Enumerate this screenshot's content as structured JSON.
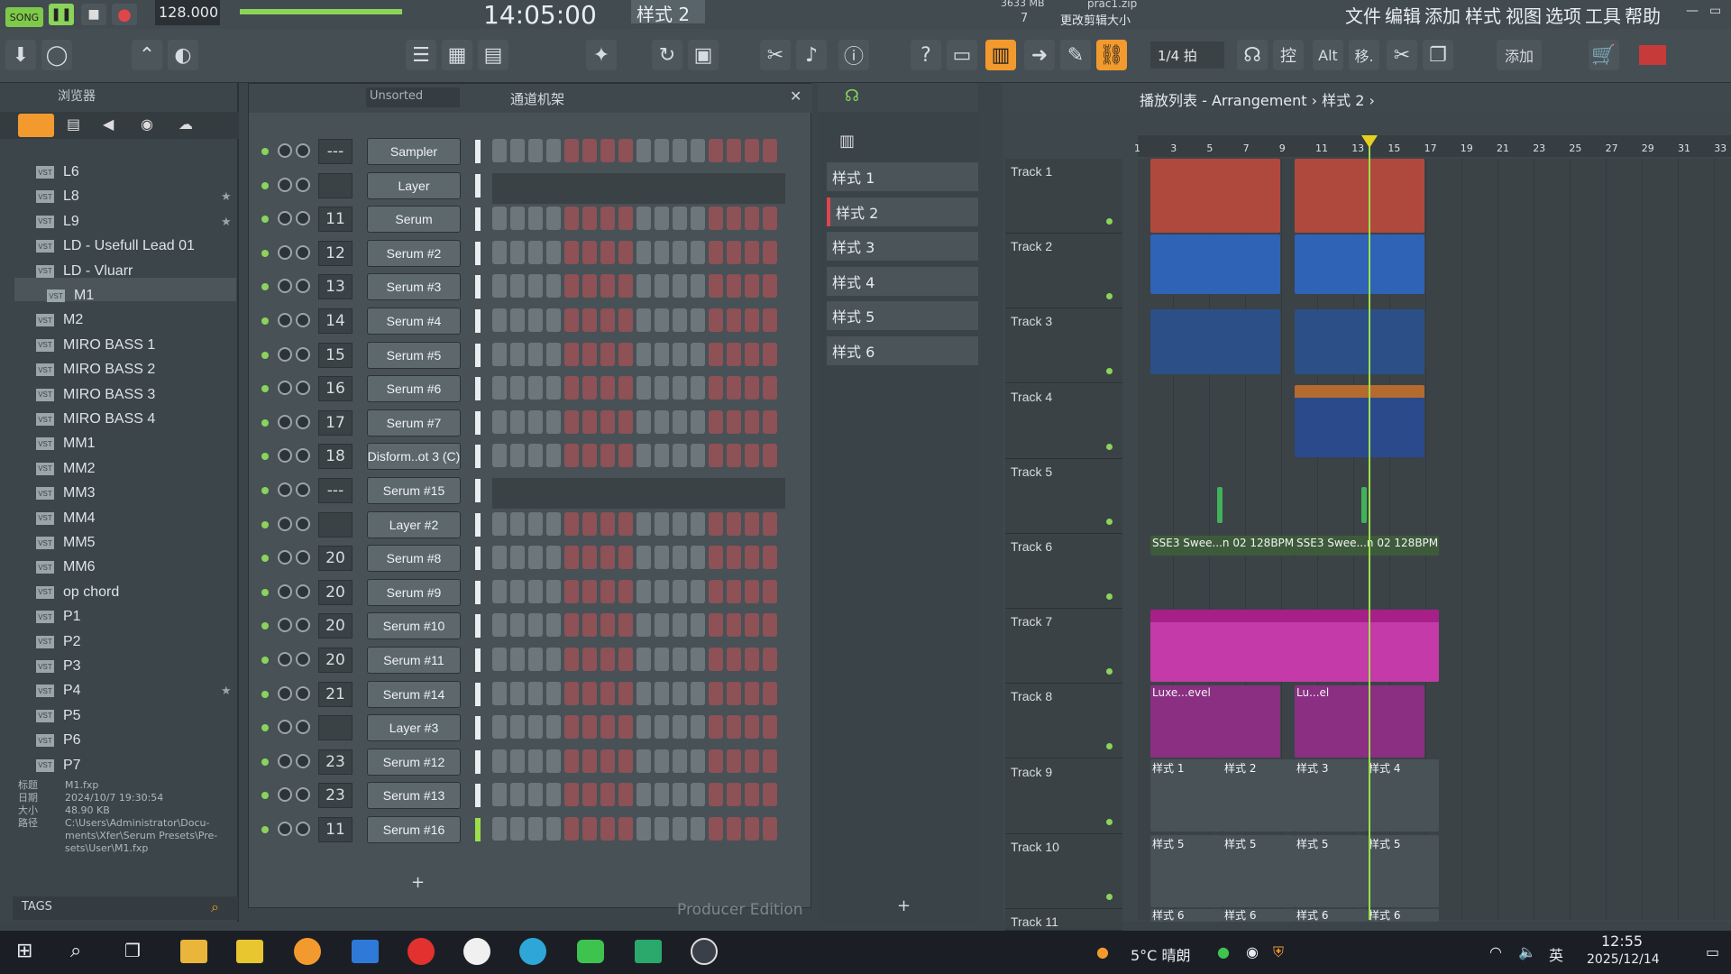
{
  "menu": {
    "tempo": "128.000",
    "time": "14:05:00",
    "pattern": "样式 2",
    "file": "prac1.zip",
    "hint": "更改剪辑大小",
    "mem": "3633 MB",
    "cpu": "7",
    "items": [
      "文件",
      "编辑",
      "添加",
      "样式",
      "视图",
      "选项",
      "工具",
      "帮助"
    ]
  },
  "toolbar": {
    "snap": "1/4 拍",
    "labels": [
      "控",
      "Alt",
      "移.",
      "添加"
    ]
  },
  "browser": {
    "title": "浏览器",
    "items": [
      "L6",
      "L8",
      "L9",
      "LD - Usefull Lead 01",
      "LD - Vluarr",
      "M1",
      "M2",
      "MIRO BASS 1",
      "MIRO BASS 2",
      "MIRO BASS 3",
      "MIRO BASS 4",
      "MM1",
      "MM2",
      "MM3",
      "MM4",
      "MM5",
      "MM6",
      "op chord",
      "P1",
      "P2",
      "P3",
      "P4",
      "P5",
      "P6",
      "P7"
    ],
    "info": {
      "k1": "标题",
      "v1": "M1.fxp",
      "k2": "日期",
      "v2": "2024/10/7 19:30:54",
      "k3": "大小",
      "v3": "48.90 KB",
      "k4": "路径",
      "v4": "C:\\Users\\Administrator\\Docu- ments\\Xfer\\Serum Presets\\Pre- sets\\User\\M1.fxp"
    },
    "tags": "TAGS"
  },
  "rack": {
    "sort": "Unsorted",
    "title": "通道机架",
    "edition": "Producer Edition",
    "channels": [
      {
        "num": "---",
        "name": "Sampler"
      },
      {
        "num": "",
        "name": "Layer"
      },
      {
        "num": "11",
        "name": "Serum"
      },
      {
        "num": "12",
        "name": "Serum #2"
      },
      {
        "num": "13",
        "name": "Serum #3"
      },
      {
        "num": "14",
        "name": "Serum #4"
      },
      {
        "num": "15",
        "name": "Serum #5"
      },
      {
        "num": "16",
        "name": "Serum #6"
      },
      {
        "num": "17",
        "name": "Serum #7"
      },
      {
        "num": "18",
        "name": "Disform..ot 3 (C)"
      },
      {
        "num": "---",
        "name": "Serum #15"
      },
      {
        "num": "",
        "name": "Layer #2"
      },
      {
        "num": "20",
        "name": "Serum #8"
      },
      {
        "num": "20",
        "name": "Serum #9"
      },
      {
        "num": "20",
        "name": "Serum #10"
      },
      {
        "num": "20",
        "name": "Serum #11"
      },
      {
        "num": "21",
        "name": "Serum #14"
      },
      {
        "num": "",
        "name": "Layer #3"
      },
      {
        "num": "23",
        "name": "Serum #12"
      },
      {
        "num": "23",
        "name": "Serum #13"
      },
      {
        "num": "11",
        "name": "Serum #16"
      }
    ]
  },
  "patterns": [
    "样式 1",
    "样式 2",
    "样式 3",
    "样式 4",
    "样式 5",
    "样式 6"
  ],
  "playlist": {
    "title": "播放列表 - Arrangement › 样式 2 ›",
    "ruler": [
      "1",
      "3",
      "5",
      "7",
      "9",
      "11",
      "13",
      "15",
      "17",
      "19",
      "21",
      "23",
      "25",
      "27",
      "29",
      "31",
      "33"
    ],
    "tracks": [
      "Track 1",
      "Track 2",
      "Track 3",
      "Track 4",
      "Track 5",
      "Track 6",
      "Track 7",
      "Track 8",
      "Track 9",
      "Track 10",
      "Track 11"
    ],
    "clips": {
      "t6": "SSE3 Swee...n 02 128BPM",
      "t8": "Luxe...evel",
      "t8b": "Lu...el",
      "p1": "样式 1",
      "p2": "样式 2",
      "p3": "样式 3",
      "p4": "样式 4",
      "p5": "样式 5",
      "p6": "样式 6"
    }
  },
  "taskbar": {
    "weather": "5°C 晴朗",
    "ime": "英",
    "time": "12:55",
    "date": "2025/12/14"
  },
  "colors": {
    "accent": "#f29a2e",
    "led": "#8bd35a",
    "clip_red": "#b0493d",
    "clip_blue": "#2f63b5",
    "clip_pink": "#c43aa8"
  }
}
